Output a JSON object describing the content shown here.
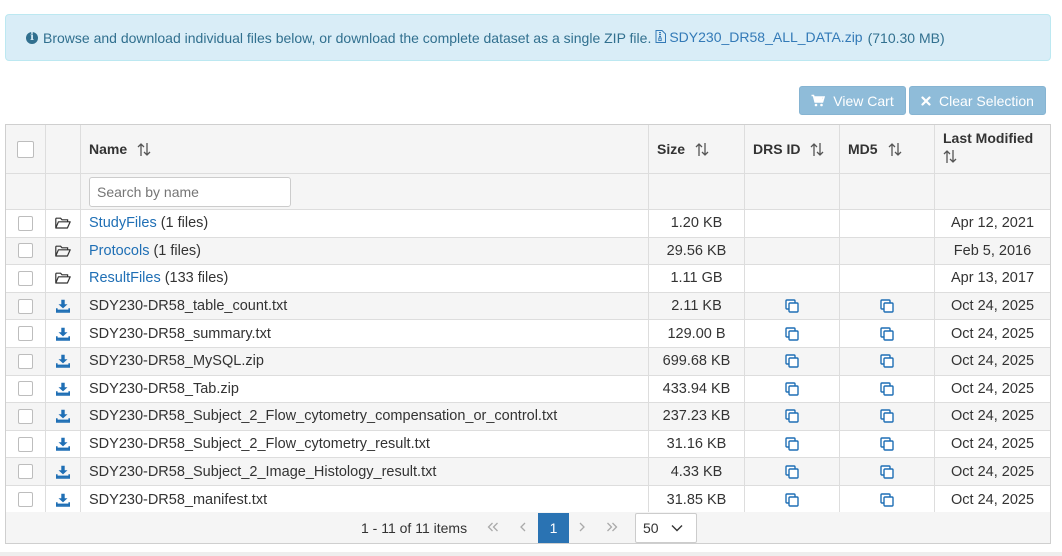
{
  "banner": {
    "text": "Browse and download individual files below, or download the complete dataset as a single ZIP file.",
    "zip_link": "SDY230_DR58_ALL_DATA.zip",
    "zip_size": "(710.30 MB)"
  },
  "toolbar": {
    "view_cart_label": "View Cart",
    "clear_selection_label": "Clear Selection"
  },
  "table": {
    "columns": {
      "name": "Name",
      "size": "Size",
      "drs": "DRS ID",
      "md5": "MD5",
      "modified": "Last Modified"
    },
    "search_placeholder": "Search by name",
    "rows": [
      {
        "type": "folder",
        "name": "StudyFiles",
        "extra": "(1 files)",
        "size": "1.20 KB",
        "modified": "Apr 12, 2021"
      },
      {
        "type": "folder",
        "name": "Protocols",
        "extra": "(1 files)",
        "size": "29.56 KB",
        "modified": "Feb 5, 2016"
      },
      {
        "type": "folder",
        "name": "ResultFiles",
        "extra": "(133 files)",
        "size": "1.11 GB",
        "modified": "Apr 13, 2017"
      },
      {
        "type": "file",
        "name": "SDY230-DR58_table_count.txt",
        "size": "2.11 KB",
        "modified": "Oct 24, 2025"
      },
      {
        "type": "file",
        "name": "SDY230-DR58_summary.txt",
        "size": "129.00 B",
        "modified": "Oct 24, 2025"
      },
      {
        "type": "file",
        "name": "SDY230-DR58_MySQL.zip",
        "size": "699.68 KB",
        "modified": "Oct 24, 2025"
      },
      {
        "type": "file",
        "name": "SDY230-DR58_Tab.zip",
        "size": "433.94 KB",
        "modified": "Oct 24, 2025"
      },
      {
        "type": "file",
        "name": "SDY230-DR58_Subject_2_Flow_cytometry_compensation_or_control.txt",
        "size": "237.23 KB",
        "modified": "Oct 24, 2025"
      },
      {
        "type": "file",
        "name": "SDY230-DR58_Subject_2_Flow_cytometry_result.txt",
        "size": "31.16 KB",
        "modified": "Oct 24, 2025"
      },
      {
        "type": "file",
        "name": "SDY230-DR58_Subject_2_Image_Histology_result.txt",
        "size": "4.33 KB",
        "modified": "Oct 24, 2025"
      },
      {
        "type": "file",
        "name": "SDY230-DR58_manifest.txt",
        "size": "31.85 KB",
        "modified": "Oct 24, 2025"
      }
    ]
  },
  "pager": {
    "info": "1 - 11 of 11 items",
    "current_page": "1",
    "page_size": "50"
  },
  "colors": {
    "banner_bg": "#d9edf7",
    "button_bg": "#8fbcd9",
    "link": "#1f6fb5",
    "pager_active": "#2a73b3"
  }
}
